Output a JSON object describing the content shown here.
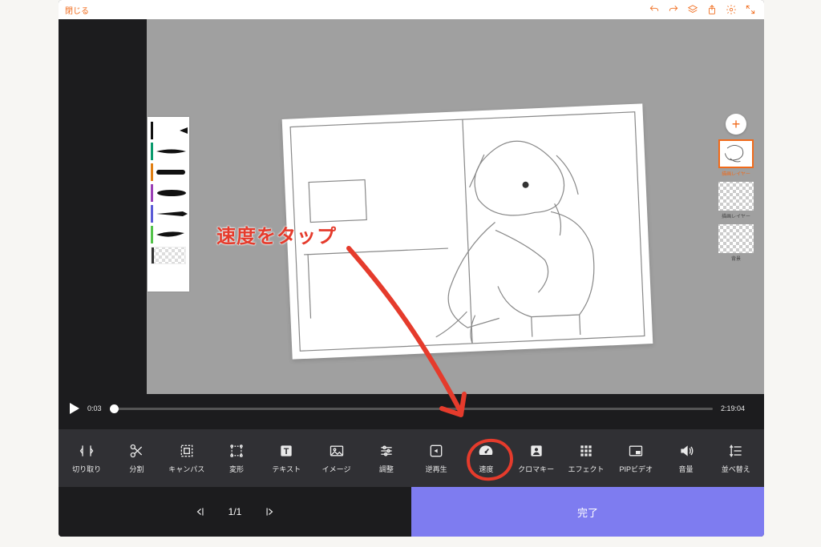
{
  "colors": {
    "accent": "#f06a1a",
    "done": "#7e7cf0",
    "annotation": "#e53b2c"
  },
  "topbar": {
    "close_label": "閉じる",
    "icons": [
      "undo",
      "redo",
      "layers",
      "share",
      "settings",
      "expand"
    ]
  },
  "layers_panel": {
    "items": [
      {
        "label": "描画レイヤー",
        "active": true,
        "checker": false
      },
      {
        "label": "描画レイヤー",
        "active": false,
        "checker": true
      },
      {
        "label": "背景",
        "active": false,
        "checker": true
      }
    ]
  },
  "playback": {
    "current_time": "0:03",
    "total_time": "2:19:04"
  },
  "toolbar": {
    "items": [
      {
        "id": "trim",
        "label": "切り取り"
      },
      {
        "id": "split",
        "label": "分割"
      },
      {
        "id": "canvas",
        "label": "キャンパス"
      },
      {
        "id": "transform",
        "label": "変形"
      },
      {
        "id": "text",
        "label": "テキスト"
      },
      {
        "id": "image",
        "label": "イメージ"
      },
      {
        "id": "adjust",
        "label": "調整"
      },
      {
        "id": "reverse",
        "label": "逆再生"
      },
      {
        "id": "speed",
        "label": "速度"
      },
      {
        "id": "chroma",
        "label": "クロマキー"
      },
      {
        "id": "effect",
        "label": "エフェクト"
      },
      {
        "id": "pip",
        "label": "PIPビデオ"
      },
      {
        "id": "volume",
        "label": "音量"
      },
      {
        "id": "reorder",
        "label": "並べ替え"
      }
    ]
  },
  "pager": {
    "page_text": "1/1"
  },
  "done_label": "完了",
  "annotation": {
    "text": "速度をタップ"
  }
}
